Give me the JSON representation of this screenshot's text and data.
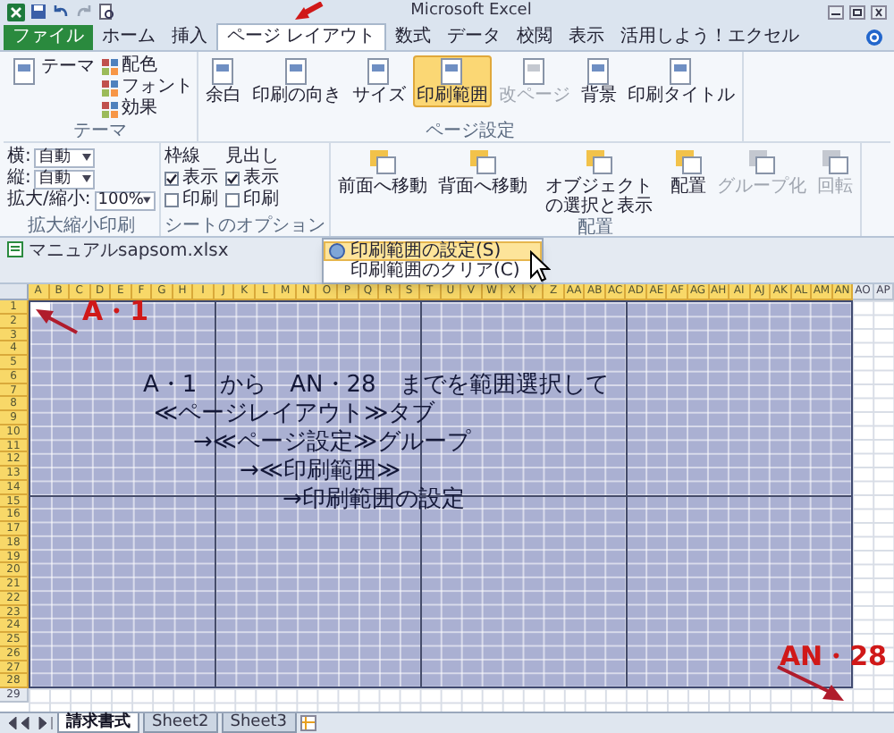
{
  "window": {
    "title": "Microsoft Excel"
  },
  "tabs": [
    {
      "label": "ファイル",
      "kind": "file",
      "selected": false
    },
    {
      "label": "ホーム",
      "kind": "tab",
      "selected": false
    },
    {
      "label": "挿入",
      "kind": "tab",
      "selected": false
    },
    {
      "label": "ページ レイアウト",
      "kind": "tab",
      "selected": true
    },
    {
      "label": "数式",
      "kind": "tab",
      "selected": false
    },
    {
      "label": "データ",
      "kind": "tab",
      "selected": false
    },
    {
      "label": "校閲",
      "kind": "tab",
      "selected": false
    },
    {
      "label": "表示",
      "kind": "tab",
      "selected": false
    },
    {
      "label": "活用しよう！エクセル",
      "kind": "tab",
      "selected": false
    }
  ],
  "ribbon": {
    "groups": [
      {
        "label": "テーマ",
        "items": [
          {
            "kind": "large",
            "label": "テーマ",
            "pressed": false,
            "disabled": false
          },
          {
            "kind": "small",
            "label": "配色",
            "disabled": false
          },
          {
            "kind": "small",
            "label": "フォント",
            "disabled": false
          },
          {
            "kind": "small",
            "label": "効果",
            "disabled": false
          }
        ]
      },
      {
        "label": "ページ設定",
        "items": [
          {
            "kind": "large",
            "label": "余白",
            "pressed": false,
            "disabled": false
          },
          {
            "kind": "large",
            "label": "印刷の向き",
            "pressed": false,
            "disabled": false
          },
          {
            "kind": "large",
            "label": "サイズ",
            "pressed": false,
            "disabled": false
          },
          {
            "kind": "large",
            "label": "印刷範囲",
            "pressed": true,
            "disabled": false
          },
          {
            "kind": "large",
            "label": "改ページ",
            "pressed": false,
            "disabled": true
          },
          {
            "kind": "large",
            "label": "背景",
            "pressed": false,
            "disabled": false
          },
          {
            "kind": "large",
            "label": "印刷タイトル",
            "pressed": false,
            "disabled": false
          }
        ]
      },
      {
        "label": "拡大縮小印刷",
        "items": [
          {
            "kind": "field",
            "label": "横:",
            "value": "自動",
            "disabled": false
          },
          {
            "kind": "field",
            "label": "縦:",
            "value": "自動",
            "disabled": false
          },
          {
            "kind": "field",
            "label": "拡大/縮小:",
            "value": "100%",
            "disabled": false
          }
        ]
      },
      {
        "label": "シートのオプション",
        "items": [
          {
            "kind": "heading",
            "label": "枠線",
            "disabled": false
          },
          {
            "kind": "check",
            "label": "表示",
            "checked": true,
            "disabled": false
          },
          {
            "kind": "check",
            "label": "印刷",
            "checked": false,
            "disabled": false
          },
          {
            "kind": "heading",
            "label": "見出し",
            "disabled": false
          },
          {
            "kind": "check",
            "label": "表示",
            "checked": true,
            "disabled": false
          },
          {
            "kind": "check",
            "label": "印刷",
            "checked": false,
            "disabled": false
          }
        ]
      },
      {
        "label": "配置",
        "items": [
          {
            "kind": "large",
            "label": "前面へ移動",
            "pressed": false,
            "disabled": false
          },
          {
            "kind": "large",
            "label": "背面へ移動",
            "pressed": false,
            "disabled": false
          },
          {
            "kind": "large",
            "label": "オブジェクトの選択と表示",
            "pressed": false,
            "disabled": false
          },
          {
            "kind": "large",
            "label": "配置",
            "pressed": false,
            "disabled": false
          },
          {
            "kind": "large",
            "label": "グループ化",
            "pressed": false,
            "disabled": true
          },
          {
            "kind": "large",
            "label": "回転",
            "pressed": false,
            "disabled": true
          }
        ]
      }
    ]
  },
  "dropdown": {
    "items": [
      {
        "label": "印刷範囲の設定(S)",
        "selected": true
      },
      {
        "label": "印刷範囲のクリア(C)",
        "selected": false
      }
    ]
  },
  "workbook": {
    "title": "マニュアルsapsom.xlsx",
    "columns": [
      {
        "label": "A",
        "selected": true
      },
      {
        "label": "B",
        "selected": true
      },
      {
        "label": "C",
        "selected": true
      },
      {
        "label": "D",
        "selected": true
      },
      {
        "label": "E",
        "selected": true
      },
      {
        "label": "F",
        "selected": true
      },
      {
        "label": "G",
        "selected": true
      },
      {
        "label": "H",
        "selected": true
      },
      {
        "label": "I",
        "selected": true
      },
      {
        "label": "J",
        "selected": true
      },
      {
        "label": "K",
        "selected": true
      },
      {
        "label": "L",
        "selected": true
      },
      {
        "label": "M",
        "selected": true
      },
      {
        "label": "N",
        "selected": true
      },
      {
        "label": "O",
        "selected": true
      },
      {
        "label": "P",
        "selected": true
      },
      {
        "label": "Q",
        "selected": true
      },
      {
        "label": "R",
        "selected": true
      },
      {
        "label": "S",
        "selected": true
      },
      {
        "label": "T",
        "selected": true
      },
      {
        "label": "U",
        "selected": true
      },
      {
        "label": "V",
        "selected": true
      },
      {
        "label": "W",
        "selected": true
      },
      {
        "label": "X",
        "selected": true
      },
      {
        "label": "Y",
        "selected": true
      },
      {
        "label": "Z",
        "selected": true
      },
      {
        "label": "AA",
        "selected": true
      },
      {
        "label": "AB",
        "selected": true
      },
      {
        "label": "AC",
        "selected": true
      },
      {
        "label": "AD",
        "selected": true
      },
      {
        "label": "AE",
        "selected": true
      },
      {
        "label": "AF",
        "selected": true
      },
      {
        "label": "AG",
        "selected": true
      },
      {
        "label": "AH",
        "selected": true
      },
      {
        "label": "AI",
        "selected": true
      },
      {
        "label": "AJ",
        "selected": true
      },
      {
        "label": "AK",
        "selected": true
      },
      {
        "label": "AL",
        "selected": true
      },
      {
        "label": "AM",
        "selected": true
      },
      {
        "label": "AN",
        "selected": true
      },
      {
        "label": "AO",
        "selected": false
      },
      {
        "label": "AP",
        "selected": false
      }
    ],
    "rows": [
      {
        "label": "1",
        "selected": true
      },
      {
        "label": "2",
        "selected": true
      },
      {
        "label": "3",
        "selected": true
      },
      {
        "label": "4",
        "selected": true
      },
      {
        "label": "5",
        "selected": true
      },
      {
        "label": "6",
        "selected": true
      },
      {
        "label": "7",
        "selected": true
      },
      {
        "label": "8",
        "selected": true
      },
      {
        "label": "9",
        "selected": true
      },
      {
        "label": "10",
        "selected": true
      },
      {
        "label": "11",
        "selected": true
      },
      {
        "label": "12",
        "selected": true
      },
      {
        "label": "13",
        "selected": true
      },
      {
        "label": "14",
        "selected": true
      },
      {
        "label": "15",
        "selected": true
      },
      {
        "label": "16",
        "selected": true
      },
      {
        "label": "17",
        "selected": true
      },
      {
        "label": "18",
        "selected": true
      },
      {
        "label": "19",
        "selected": true
      },
      {
        "label": "20",
        "selected": true
      },
      {
        "label": "21",
        "selected": true
      },
      {
        "label": "22",
        "selected": true
      },
      {
        "label": "23",
        "selected": true
      },
      {
        "label": "24",
        "selected": true
      },
      {
        "label": "25",
        "selected": true
      },
      {
        "label": "26",
        "selected": true
      },
      {
        "label": "27",
        "selected": true
      },
      {
        "label": "28",
        "selected": true
      },
      {
        "label": "29",
        "selected": false
      }
    ]
  },
  "annotations": {
    "start_label": "A・1",
    "end_label": "AN・28",
    "instructions": [
      "A・1　から　AN・28　までを範囲選択して",
      "≪ページレイアウト≫タブ",
      "→≪ページ設定≫グループ",
      "→≪印刷範囲≫",
      "→印刷範囲の設定"
    ]
  },
  "sheet_tabs": [
    {
      "label": "請求書式",
      "selected": true
    },
    {
      "label": "Sheet2",
      "selected": false
    },
    {
      "label": "Sheet3",
      "selected": false
    }
  ]
}
